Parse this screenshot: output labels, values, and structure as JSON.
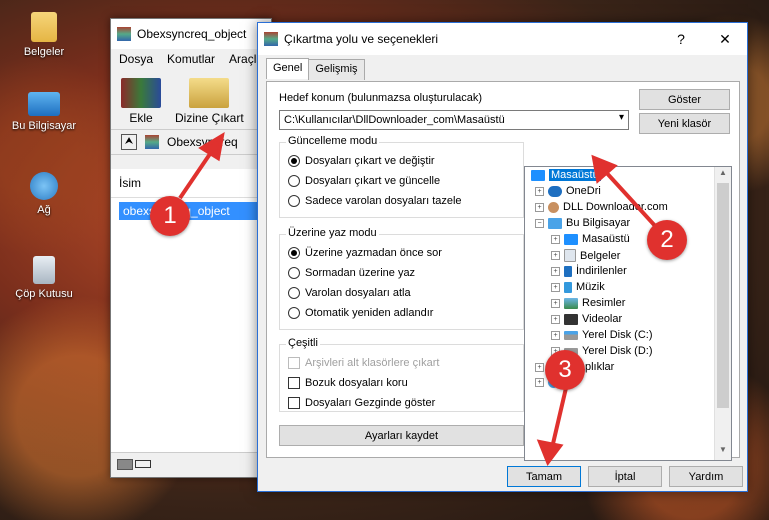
{
  "desktop": {
    "icons": [
      {
        "label": "Belgeler"
      },
      {
        "label": "Bu Bilgisayar"
      },
      {
        "label": "Ağ"
      },
      {
        "label": "Çöp Kutusu"
      }
    ]
  },
  "winrar": {
    "title": "Obexsyncreq_object",
    "menu": [
      "Dosya",
      "Komutlar",
      "Araçla"
    ],
    "tools": [
      {
        "label": "Ekle"
      },
      {
        "label": "Dizine Çıkart"
      }
    ],
    "address": "Obexsyncreq",
    "list_header": "İsim",
    "list_item": "obexsyncreq_object"
  },
  "dialog": {
    "title": "Çıkartma yolu ve seçenekleri",
    "help": "?",
    "close": "✕",
    "tabs": [
      "Genel",
      "Gelişmiş"
    ],
    "dest_label": "Hedef konum (bulunmazsa oluşturulacak)",
    "dest_value": "C:\\Kullanıcılar\\DllDownloader_com\\Masaüstü",
    "show_button": "Göster",
    "new_folder_button": "Yeni klasör",
    "update_group": {
      "title": "Güncelleme modu",
      "options": [
        "Dosyaları çıkart ve değiştir",
        "Dosyaları çıkart ve güncelle",
        "Sadece varolan dosyaları tazele"
      ],
      "selected": 0
    },
    "overwrite_group": {
      "title": "Üzerine yaz modu",
      "options": [
        "Üzerine yazmadan önce sor",
        "Sormadan üzerine yaz",
        "Varolan dosyaları atla",
        "Otomatik yeniden adlandır"
      ],
      "selected": 0
    },
    "misc_group": {
      "title": "Çeşitli",
      "options": [
        "Arşivleri alt klasörlere çıkart",
        "Bozuk dosyaları koru",
        "Dosyaları Gezginde göster"
      ]
    },
    "save_settings_button": "Ayarları kaydet",
    "tree": [
      {
        "label": "Masaüstü",
        "selected": true
      },
      {
        "label": "OneDri"
      },
      {
        "label": "DLL Downloader.com"
      },
      {
        "label": "Bu Bilgisayar"
      },
      {
        "label": "Masaüstü"
      },
      {
        "label": "Belgeler"
      },
      {
        "label": "İndirilenler"
      },
      {
        "label": "Müzik"
      },
      {
        "label": "Resimler"
      },
      {
        "label": "Videolar"
      },
      {
        "label": "Yerel Disk (C:)"
      },
      {
        "label": "Yerel Disk (D:)"
      },
      {
        "label": "Kitaplıklar"
      }
    ],
    "ok_button": "Tamam",
    "cancel_button": "İptal",
    "help_button": "Yardım"
  },
  "markers": [
    "1",
    "2",
    "3"
  ],
  "colors": {
    "accent": "#0078d7",
    "marker": "#e0312e"
  }
}
